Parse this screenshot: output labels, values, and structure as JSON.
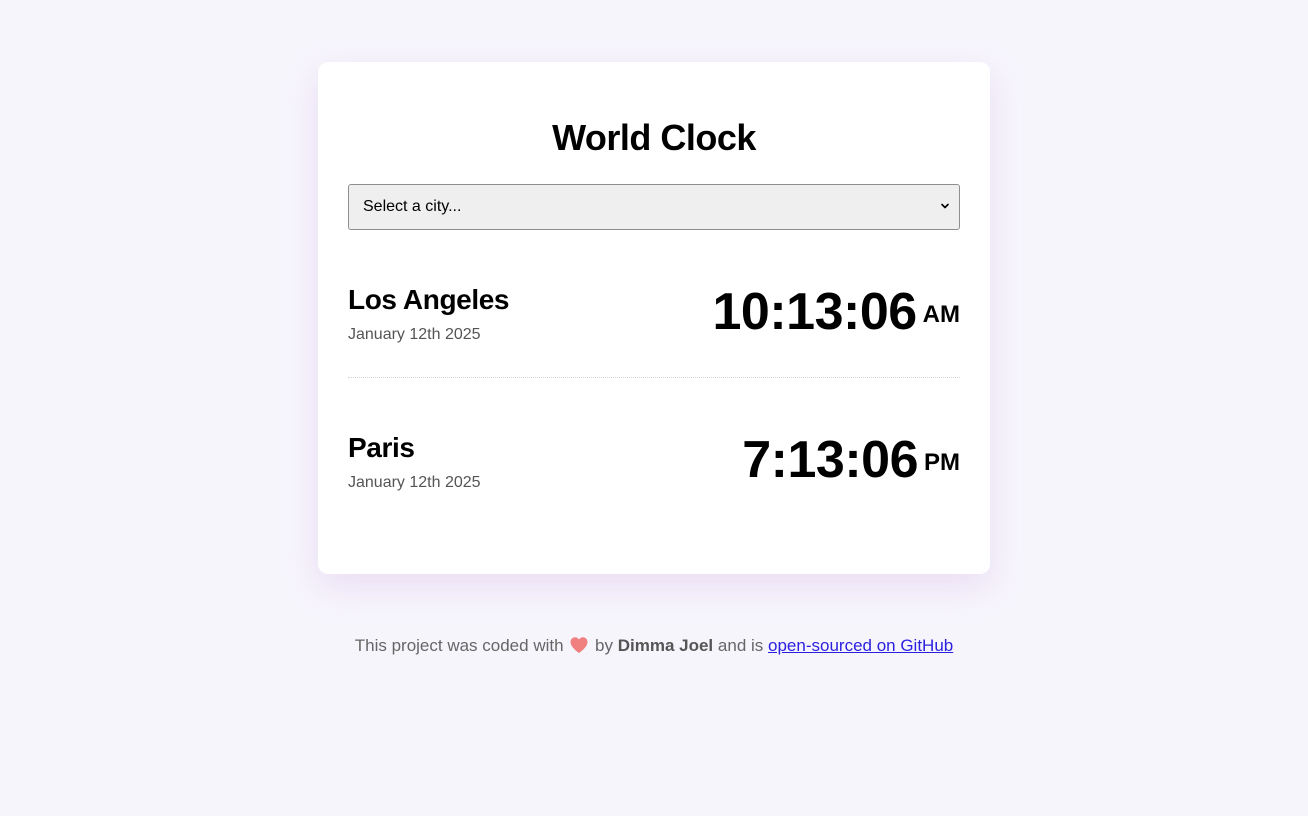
{
  "app": {
    "title": "World Clock"
  },
  "city_select": {
    "selected_label": "Select a city..."
  },
  "cities": [
    {
      "name": "Los Angeles",
      "date": "January 12th 2025",
      "time": "10:13:06",
      "period": "AM"
    },
    {
      "name": "Paris",
      "date": "January 12th 2025",
      "time": "7:13:06",
      "period": "PM"
    }
  ],
  "footer": {
    "text_before": "This project was coded with",
    "text_by": "by",
    "author": "Dimma Joel",
    "text_and": "and is",
    "link_label": "open-sourced on GitHub",
    "heart_icon": "heart-icon"
  },
  "colors": {
    "background": "#f7f5fc",
    "card": "#ffffff",
    "heart": "#f07f7f",
    "link": "#2a1fe0"
  }
}
